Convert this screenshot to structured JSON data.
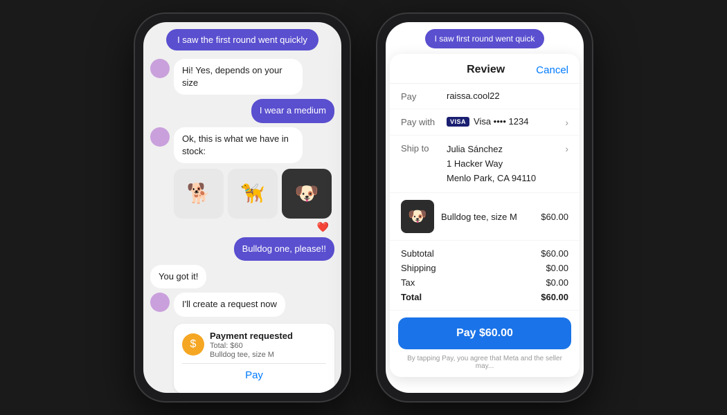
{
  "chat": {
    "header_bubble": "I saw the first round went quickly",
    "messages": [
      {
        "id": "msg1",
        "type": "incoming",
        "text": "Hi! Yes, depends on your size",
        "has_avatar": true
      },
      {
        "id": "msg2",
        "type": "outgoing",
        "text": "I wear a medium"
      },
      {
        "id": "msg3",
        "type": "incoming",
        "text": "Ok, this is what we have in stock:",
        "has_avatar": true
      },
      {
        "id": "msg4",
        "type": "outgoing",
        "text": "Bulldog one, please!!"
      }
    ],
    "you_got_it": "You got it!",
    "create_request": "I'll create a request now",
    "payment_card": {
      "title": "Payment requested",
      "total": "Total: $60",
      "item": "Bulldog tee, size M",
      "pay_btn": "Pay"
    }
  },
  "review": {
    "header_bubble": "I saw first round went quick",
    "title": "Review",
    "cancel": "Cancel",
    "pay_label": "Pay",
    "pay_value": "raissa.cool22",
    "pay_with_label": "Pay with",
    "visa_text": "VISA",
    "visa_card": "Visa •••• 1234",
    "ship_to_label": "Ship to",
    "ship_name": "Julia Sánchez",
    "ship_address1": "1 Hacker Way",
    "ship_address2": "Menlo Park, CA 94110",
    "product_name": "Bulldog tee, size M",
    "product_price": "$60.00",
    "subtotal_label": "Subtotal",
    "subtotal_value": "$60.00",
    "shipping_label": "Shipping",
    "shipping_value": "$0.00",
    "tax_label": "Tax",
    "tax_value": "$0.00",
    "total_label": "Total",
    "total_value": "$60.00",
    "pay_button": "Pay $60.00",
    "fine_print": "By tapping Pay, you agree that Meta and the seller may..."
  }
}
